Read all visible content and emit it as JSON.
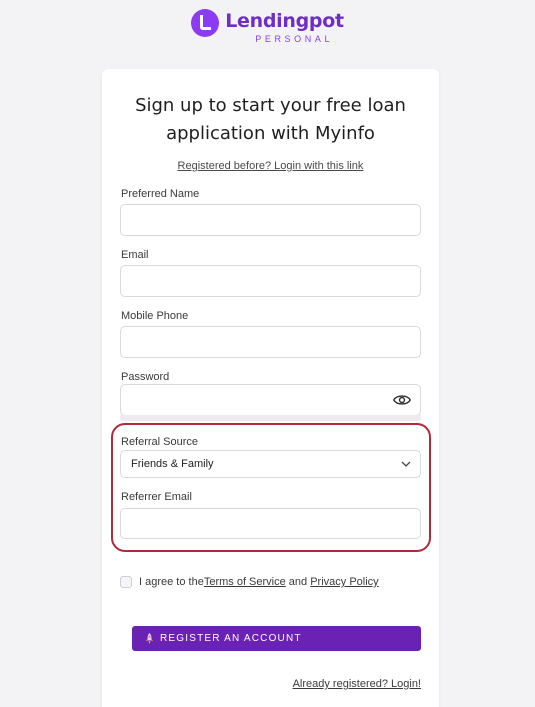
{
  "brand": {
    "name": "Lendingpot",
    "subtitle": "PERSONAL",
    "accent_color": "#8b3cf2",
    "icon": "lendingpot-logo-icon"
  },
  "form": {
    "title_line1": "Sign up to start your free loan",
    "title_line2": "application with Myinfo",
    "login_link": "Registered before? Login with this link",
    "fields": {
      "preferred_name": {
        "label": "Preferred Name",
        "value": ""
      },
      "email": {
        "label": "Email",
        "value": ""
      },
      "mobile_phone": {
        "label": "Mobile Phone",
        "value": ""
      },
      "password": {
        "label": "Password",
        "value": "",
        "icon": "eye-icon"
      },
      "referral_source": {
        "label": "Referral Source",
        "selected": "Friends & Family",
        "icon": "chevron-down-icon"
      },
      "referrer_email": {
        "label": "Referrer Email",
        "value": ""
      }
    },
    "agree": {
      "prefix": "I agree to the ",
      "terms": "Terms of Service",
      "middle": " and ",
      "privacy": "Privacy Policy"
    },
    "register_button": {
      "label": "REGISTER AN ACCOUNT",
      "icon": "rocket-icon",
      "color": "#6a22b5"
    },
    "already_link": "Already registered? Login!"
  },
  "highlight_color": "#b02a3c"
}
